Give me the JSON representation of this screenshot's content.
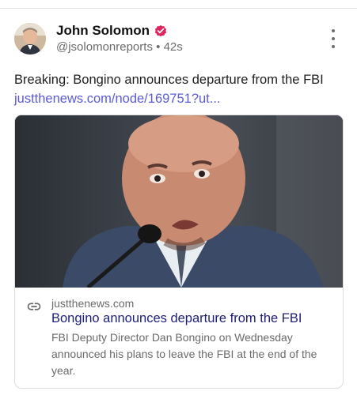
{
  "post": {
    "author_name": "John Solomon",
    "handle": "@jsolomonreports",
    "separator": "•",
    "time_ago": "42s",
    "text_line": "Breaking: Bongino announces departure from the FBI",
    "link_text": "justthenews.com/node/169751?ut..."
  },
  "card": {
    "domain": "justthenews.com",
    "title": "Bongino announces departure from the FBI",
    "description": "FBI Deputy Director Dan Bongino on Wednesday announced his plans to leave the FBI at the end of the year."
  },
  "colors": {
    "verified_badge": "#e0245e",
    "link": "#5b5bd6",
    "card_title": "#1d1d7a"
  },
  "icons": {
    "verified": "verified-badge-icon",
    "more": "more-vertical-icon",
    "link": "link-icon"
  }
}
